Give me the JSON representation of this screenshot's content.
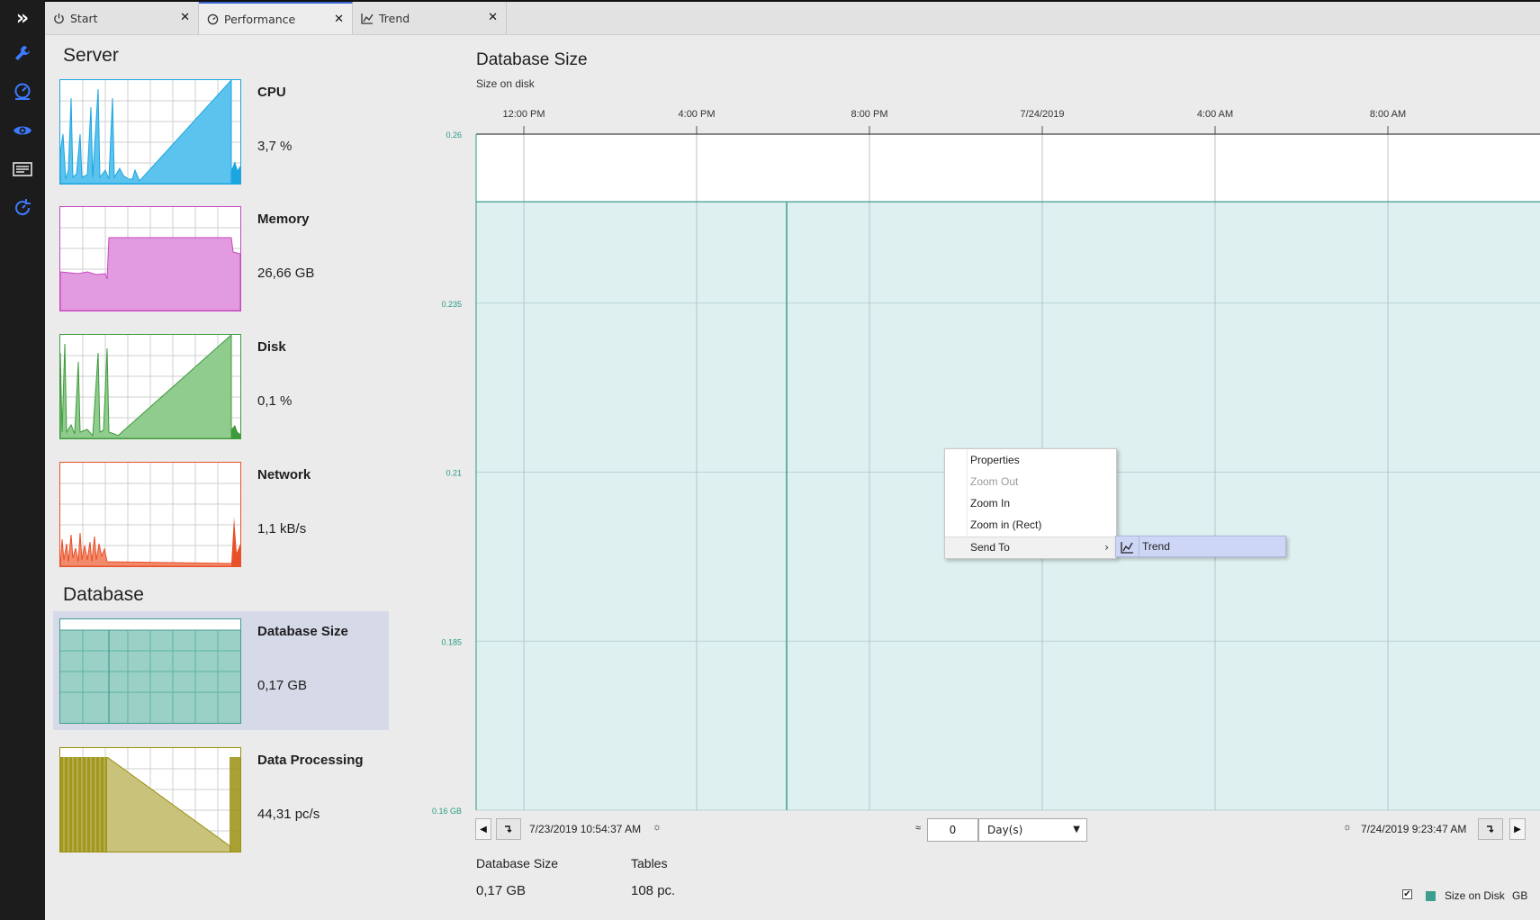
{
  "tabs": [
    {
      "label": "Start",
      "icon": "power-icon"
    },
    {
      "label": "Performance",
      "icon": "gauge-icon"
    },
    {
      "label": "Trend",
      "icon": "trend-icon"
    }
  ],
  "sidebar_icons": [
    "expand-icon",
    "wrench-icon",
    "dashboard-icon",
    "eye-icon",
    "report-icon",
    "refresh-gauge-icon"
  ],
  "sections": {
    "server": "Server",
    "database": "Database"
  },
  "metrics": {
    "cpu": {
      "title": "CPU",
      "value": "3,7 %",
      "color": "#1ba6e0"
    },
    "memory": {
      "title": "Memory",
      "value": "26,66 GB",
      "color": "#c648c0"
    },
    "disk": {
      "title": "Disk",
      "value": "0,1 %",
      "color": "#3f9a3c"
    },
    "network": {
      "title": "Network",
      "value": "1,1 kB/s",
      "color": "#e8502a"
    },
    "dbsize": {
      "title": "Database Size",
      "value": "0,17 GB",
      "color": "#3d9e8e"
    },
    "dataproc": {
      "title": "Data Processing",
      "value": "44,31 pc/s",
      "color": "#9a9010"
    }
  },
  "chart": {
    "title": "Database Size",
    "subtitle": "Size on disk",
    "time_labels": [
      "12:00 PM",
      "4:00 PM",
      "8:00 PM",
      "7/24/2019",
      "4:00 AM",
      "8:00 AM"
    ],
    "y_ticks": [
      "0.26",
      "0.235",
      "0.21",
      "0.185",
      "0.16 GB"
    ],
    "start_time": "7/23/2019 10:54:37 AM",
    "end_time": "7/24/2019 9:23:47 AM",
    "span_value": "0",
    "span_unit": "Day(s)",
    "approx_symbol": "≈"
  },
  "chart_data": {
    "type": "area",
    "title": "Database Size",
    "subtitle": "Size on disk",
    "x": [
      "7/23/2019 10:54:37 AM",
      "7/24/2019 9:23:47 AM"
    ],
    "series": [
      {
        "name": "Size on Disk",
        "values": [
          0.25,
          0.25
        ]
      }
    ],
    "ylim": [
      0.16,
      0.26
    ],
    "yticks": [
      0.26,
      0.235,
      0.21,
      0.185,
      0.16
    ],
    "ytick_labels": [
      "0.26",
      "0.235",
      "0.21",
      "0.185",
      "0.16 GB"
    ],
    "xticks": [
      "12:00 PM",
      "4:00 PM",
      "8:00 PM",
      "7/24/2019",
      "4:00 AM",
      "8:00 AM"
    ],
    "unit": "GB",
    "grid": true,
    "legend": "bottom-right"
  },
  "summary": {
    "db_size_label": "Database Size",
    "db_size_value": "0,17 GB",
    "tables_label": "Tables",
    "tables_value": "108 pc."
  },
  "legend": {
    "label": "Size on Disk",
    "unit": "GB",
    "checked": true,
    "color": "#3d9e8e"
  },
  "context_menu": {
    "items": [
      {
        "label": "Properties",
        "enabled": true
      },
      {
        "label": "Zoom Out",
        "enabled": false
      },
      {
        "label": "Zoom In",
        "enabled": true
      },
      {
        "label": "Zoom in (Rect)",
        "enabled": true
      },
      {
        "label": "Send To",
        "enabled": true
      }
    ],
    "submenu": [
      {
        "label": "Trend",
        "icon": "trend-icon"
      }
    ]
  }
}
